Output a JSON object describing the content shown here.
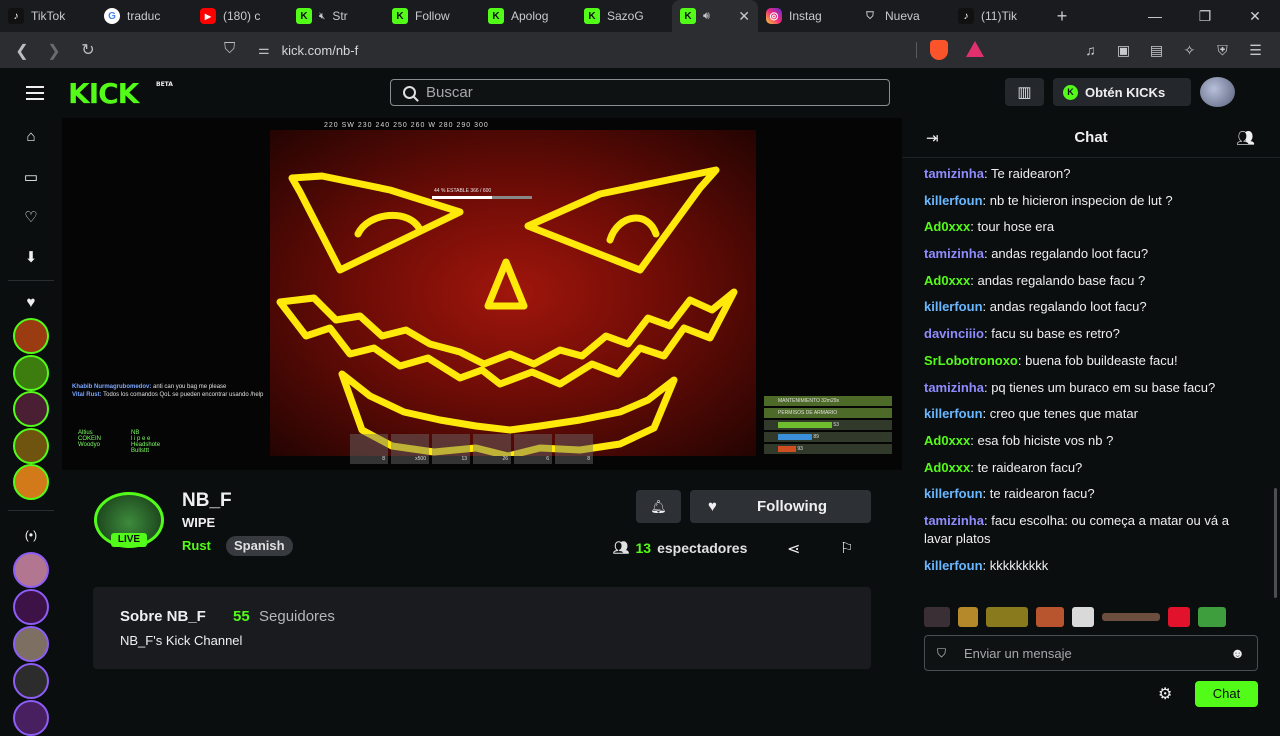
{
  "browser": {
    "tabs": [
      {
        "label": "TikTok",
        "icon": "tiktok",
        "glyph": "♪"
      },
      {
        "label": "traduc",
        "icon": "google",
        "glyph": "G"
      },
      {
        "label": "(180) c",
        "icon": "yt",
        "glyph": "▶"
      },
      {
        "label": "Str",
        "icon": "kick",
        "glyph": "K",
        "muted": true
      },
      {
        "label": "Follow",
        "icon": "kick",
        "glyph": "K"
      },
      {
        "label": "Apolog",
        "icon": "kick",
        "glyph": "K"
      },
      {
        "label": "SazoG",
        "icon": "kick",
        "glyph": "K"
      },
      {
        "label": "",
        "icon": "kick",
        "glyph": "K",
        "active": true
      },
      {
        "label": "Instag",
        "icon": "insta",
        "glyph": "◎"
      },
      {
        "label": "Nueva",
        "icon": "shield",
        "glyph": "⛉"
      },
      {
        "label": "(11)Tik",
        "icon": "tiktok",
        "glyph": "♪"
      }
    ],
    "url": "kick.com/nb-f"
  },
  "header": {
    "logo": "KICK",
    "logo_badge": "BETA",
    "search_placeholder": "Buscar",
    "get_kicks_label": "Obtén KICKs"
  },
  "video_hud": {
    "compass": "220  SW  230      240      250      260      W      280      290      300",
    "bar_label": "44 % ESTABLE   366 / 600",
    "chat_lines": [
      {
        "user": "Khabib Nurmagrubomedov:",
        "text": "anti  can you bag me please"
      },
      {
        "user": "Vital Rust:",
        "text": "Todos los comandos QoL se pueden encontrar usando /help"
      }
    ],
    "team_left": [
      "Altius",
      "COKEIN",
      "Woodyo"
    ],
    "team_right": [
      "NB",
      "l i p e e",
      "Headshote",
      "Bullsttt"
    ],
    "panel_rows": [
      "MANTENIMIENTO  32m29s",
      "PERMISOS DE ARMARIO",
      "53",
      "89",
      "93"
    ],
    "hotbar_counts": [
      "8",
      "x500",
      "13",
      "26",
      "6",
      "8"
    ]
  },
  "stream": {
    "name": "NB_F",
    "title": "WIPE",
    "category": "Rust",
    "tag": "Spanish",
    "live_label": "LIVE",
    "follow_label": "Following",
    "viewer_count": "13",
    "viewer_label": "espectadores"
  },
  "about": {
    "title": "Sobre NB_F",
    "followers_count": "55",
    "followers_label": "Seguidores",
    "description": "NB_F's Kick Channel"
  },
  "chat": {
    "title": "Chat",
    "input_placeholder": "Enviar un mensaje",
    "send_label": "Chat",
    "messages": [
      {
        "user": "tamizinha",
        "color": "#8f8cff",
        "text": "Te raidearon?"
      },
      {
        "user": "killerfoun",
        "color": "#6ab7ff",
        "text": "nb te hicieron inspecion de lut ?"
      },
      {
        "user": "Ad0xxx",
        "color": "#53fc18",
        "text": "tour hose era"
      },
      {
        "user": "tamizinha",
        "color": "#8f8cff",
        "text": "andas regalando loot facu?"
      },
      {
        "user": "Ad0xxx",
        "color": "#53fc18",
        "text": "andas regalando base facu ?"
      },
      {
        "user": "killerfoun",
        "color": "#6ab7ff",
        "text": "andas regalando loot facu?"
      },
      {
        "user": "davinciiio",
        "color": "#8f8cff",
        "text": "facu su base es retro?"
      },
      {
        "user": "SrLobotronoxo",
        "color": "#53fc18",
        "text": "buena fob buildeaste facu!"
      },
      {
        "user": "tamizinha",
        "color": "#8f8cff",
        "text": "pq tienes um buraco em su base facu?"
      },
      {
        "user": "killerfoun",
        "color": "#6ab7ff",
        "text": "creo que tenes que matar"
      },
      {
        "user": "Ad0xxx",
        "color": "#53fc18",
        "text": "esa fob hiciste vos nb ?"
      },
      {
        "user": "Ad0xxx",
        "color": "#53fc18",
        "text": "te raidearon facu?"
      },
      {
        "user": "killerfoun",
        "color": "#6ab7ff",
        "text": "te raidearon facu?"
      },
      {
        "user": "tamizinha",
        "color": "#8f8cff",
        "text": "facu escolha: ou começa a matar ou vá a lavar platos"
      },
      {
        "user": "killerfoun",
        "color": "#6ab7ff",
        "text": "kkkkkkkkk"
      }
    ]
  },
  "colors": {
    "kick_green": "#53fc18",
    "background": "#0b0e0f",
    "panel": "#191b1f",
    "button": "#2d3035"
  }
}
